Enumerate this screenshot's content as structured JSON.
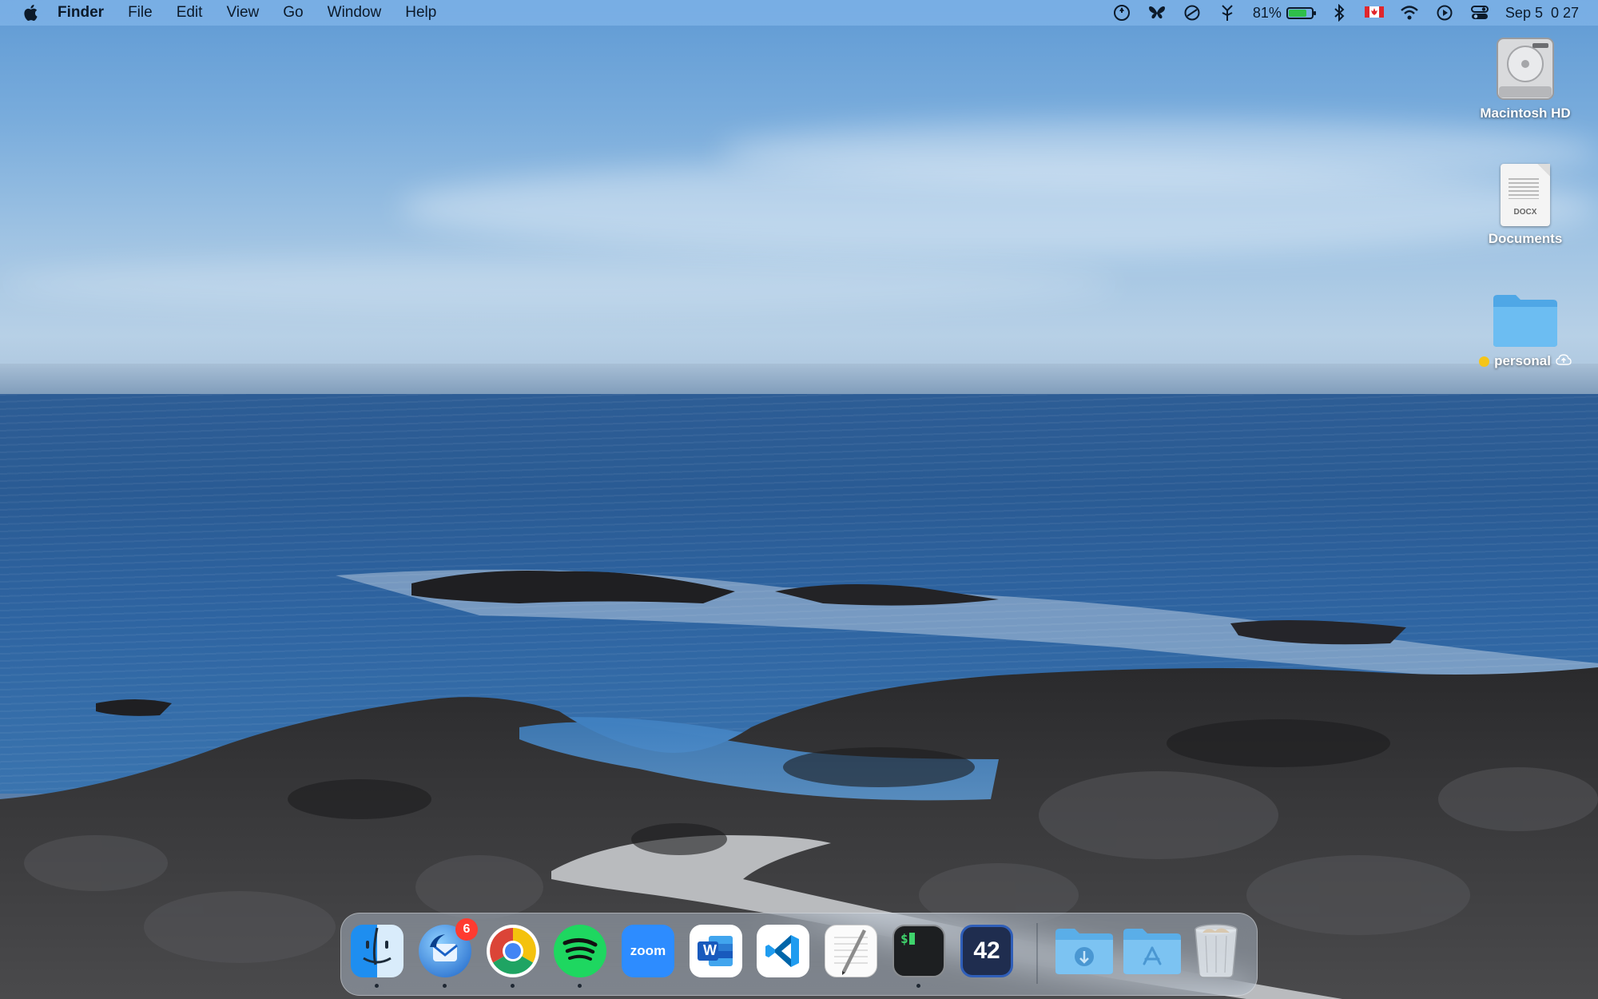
{
  "menubar": {
    "app_name": "Finder",
    "menus": [
      "File",
      "Edit",
      "View",
      "Go",
      "Window",
      "Help"
    ],
    "status": {
      "battery_percent": "81%",
      "battery_level": 0.81,
      "date_time": "Sep 5  0 27",
      "icons": [
        "timer-icon",
        "butterfly-icon",
        "do-not-disturb-icon",
        "fork-icon",
        "battery-icon",
        "bluetooth-icon",
        "canada-flag-icon",
        "wifi-icon",
        "play-icon",
        "control-center-icon"
      ]
    }
  },
  "desktop": {
    "items": [
      {
        "label": "Macintosh HD",
        "icon": "hard-drive-icon"
      },
      {
        "label": "Documents",
        "icon": "docx-file-icon",
        "ext": "DOCX"
      },
      {
        "label": "personal",
        "icon": "folder-icon",
        "tag_color": "#f5c518"
      }
    ]
  },
  "dock": {
    "apps": [
      {
        "name": "Finder",
        "icon": "finder-icon",
        "running": true
      },
      {
        "name": "Thunderbird",
        "icon": "thunderbird-icon",
        "running": true,
        "badge": "6"
      },
      {
        "name": "Chrome",
        "icon": "chrome-icon",
        "running": true
      },
      {
        "name": "Spotify",
        "icon": "spotify-icon",
        "running": true
      },
      {
        "name": "Zoom",
        "icon": "zoom-icon",
        "label": "zoom",
        "running": false
      },
      {
        "name": "Word",
        "icon": "word-icon",
        "label": "W",
        "running": false
      },
      {
        "name": "VS Code",
        "icon": "vscode-icon",
        "running": false
      },
      {
        "name": "TextEdit",
        "icon": "textedit-icon",
        "running": false
      },
      {
        "name": "Terminal",
        "icon": "terminal-icon",
        "label": "$",
        "running": true
      },
      {
        "name": "42",
        "icon": "app-42-icon",
        "label": "42",
        "running": false
      },
      {
        "name": "Downloads",
        "icon": "downloads-folder-icon",
        "running": false
      },
      {
        "name": "Applications",
        "icon": "applications-folder-icon",
        "running": false
      },
      {
        "name": "Trash",
        "icon": "trash-icon",
        "running": false
      }
    ]
  }
}
